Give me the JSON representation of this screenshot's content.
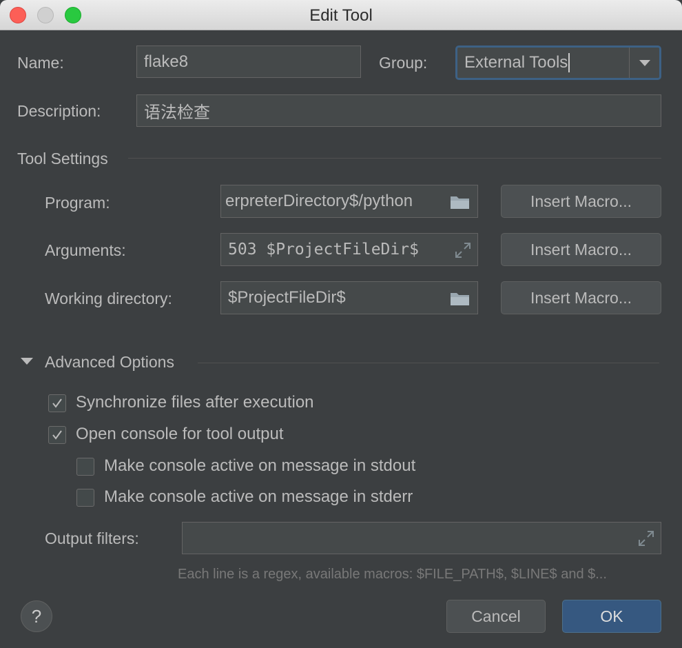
{
  "window": {
    "title": "Edit Tool"
  },
  "name": {
    "label": "Name:",
    "value": "flake8"
  },
  "group": {
    "label": "Group:",
    "value": "External Tools"
  },
  "description": {
    "label": "Description:",
    "value": "语法检查"
  },
  "tool_settings": {
    "heading": "Tool Settings",
    "program": {
      "label": "Program:",
      "value": "erpreterDirectory$/python",
      "button": "Insert Macro..."
    },
    "arguments": {
      "label": "Arguments:",
      "value": "503 $ProjectFileDir$",
      "button": "Insert Macro..."
    },
    "working_directory": {
      "label": "Working directory:",
      "value": "$ProjectFileDir$",
      "button": "Insert Macro..."
    }
  },
  "advanced": {
    "heading": "Advanced Options",
    "options": [
      {
        "label": "Synchronize files after execution",
        "checked": true
      },
      {
        "label": "Open console for tool output",
        "checked": true
      },
      {
        "label": "Make console active on message in stdout",
        "checked": false
      },
      {
        "label": "Make console active on message in stderr",
        "checked": false
      }
    ],
    "output_filters": {
      "label": "Output filters:",
      "value": ""
    },
    "hint": "Each line is a regex, available macros: $FILE_PATH$, $LINE$ and $..."
  },
  "footer": {
    "help": "?",
    "cancel": "Cancel",
    "ok": "OK"
  },
  "colors": {
    "background": "#3c3f41",
    "field": "#45494a",
    "ok_button": "#365880",
    "focus_border": "#3d6185"
  }
}
